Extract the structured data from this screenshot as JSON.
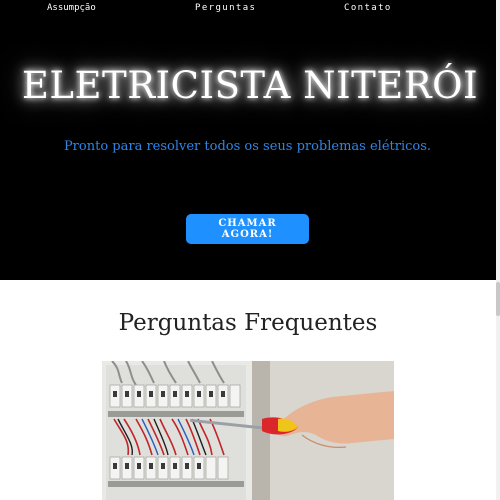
{
  "nav": {
    "items": [
      {
        "label": "Assumpção"
      },
      {
        "label": "Perguntas"
      },
      {
        "label": "Contato"
      }
    ]
  },
  "hero": {
    "title": "ELETRICISTA NITERÓI",
    "subtitle": "Pronto para resolver todos os seus problemas elétricos.",
    "cta_label": "CHAMAR AGORA!"
  },
  "faq": {
    "title": "Perguntas Frequentes"
  },
  "colors": {
    "hero_background": "#000000",
    "subtitle": "#2f86e8",
    "cta_background": "#1e90ff",
    "page_background": "#ffffff"
  }
}
